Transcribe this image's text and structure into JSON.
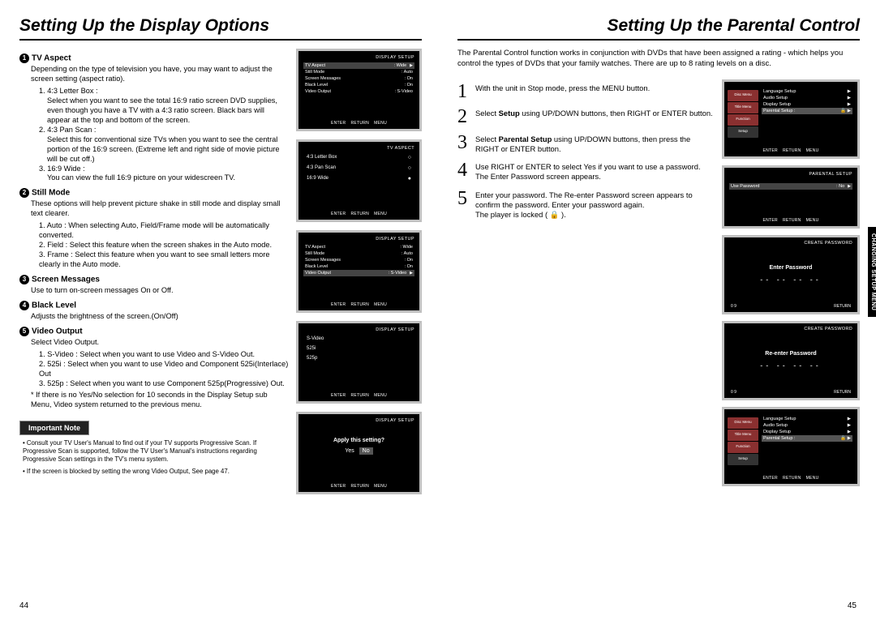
{
  "left": {
    "title": "Setting Up the Display Options",
    "sections": {
      "tvAspect": {
        "heading": "TV Aspect",
        "intro": "Depending on the type of television you have, you may want to adjust the screen setting (aspect ratio).",
        "items": [
          "1. 4:3 Letter Box :",
          "Select when you want to see the total 16:9 ratio screen DVD supplies, even though you have a TV with a 4:3 ratio screen. Black bars will appear at the top and bottom of the screen.",
          "2. 4:3 Pan Scan :",
          "Select this for conventional size TVs when you want to see the central portion of the 16:9 screen. (Extreme left and right side of movie picture will be cut off.)",
          "3. 16:9 Wide :",
          "You can view the full 16:9 picture on your widescreen TV."
        ]
      },
      "stillMode": {
        "heading": "Still Mode",
        "intro": "These options will help prevent picture shake in still mode and display small text clearer.",
        "items": [
          "1. Auto : When selecting Auto, Field/Frame mode will be automatically converted.",
          "2. Field : Select this feature when the screen shakes in the Auto mode.",
          "3. Frame : Select this feature when you want to see small letters more clearly in the Auto mode."
        ]
      },
      "screenMsg": {
        "heading": "Screen Messages",
        "body": "Use to turn on-screen messages On or Off."
      },
      "blackLevel": {
        "heading": "Black Level",
        "body": "Adjusts the brightness of the screen.(On/Off)"
      },
      "videoOut": {
        "heading": "Video Output",
        "intro": "Select Video Output.",
        "items": [
          "1. S-Video : Select when you want to use Video and S-Video Out.",
          "2. 525i : Select when you want to use Video and Component 525i(Interlace) Out",
          "3. 525p : Select when you want to use Component 525p(Progressive) Out."
        ],
        "note": "* If there is no Yes/No selection for 10 seconds in the Display Setup sub Menu, Video system returned to the previous menu."
      }
    },
    "importantNote": "Important Note",
    "finePrint": [
      "Consult your TV User's Manual to find out if your TV supports Progressive Scan. If Progressive Scan is supported, follow the TV User's Manual's instructions regarding Progressive Scan settings in the TV's menu system.",
      "If the screen is blocked by setting the wrong Video Output, See page 47."
    ],
    "pageNum": "44",
    "thumbs": {
      "displaySetup": "DISPLAY SETUP",
      "tvAspectTitle": "TV ASPECT",
      "footer": [
        "ENTER",
        "RETURN",
        "MENU"
      ],
      "rows1": [
        [
          "TV Aspect",
          ": Wide"
        ],
        [
          "Still Mode",
          ": Auto"
        ],
        [
          "Screen Messages",
          ": On"
        ],
        [
          "Black Level",
          ": On"
        ],
        [
          "Video Output",
          ": S-Video"
        ]
      ],
      "opts2": [
        "4:3 Letter Box",
        "4:3 Pan Scan",
        "16:9 Wide"
      ],
      "opts4": [
        "S-Video",
        "525i",
        "525p"
      ],
      "applyQ": "Apply this setting?",
      "yes": "Yes",
      "no": "No"
    }
  },
  "right": {
    "title": "Setting Up the Parental Control",
    "intro": "The Parental Control function works in conjunction with DVDs that have been assigned a rating - which helps you control the types of DVDs that your family watches. There are up to 8 rating levels on a disc.",
    "steps": [
      {
        "n": "1",
        "text": "With the unit in Stop mode, press the MENU button."
      },
      {
        "n": "2",
        "pre": "Select ",
        "bold": "Setup",
        "post": " using UP/DOWN buttons, then RIGHT or ENTER button."
      },
      {
        "n": "3",
        "pre": "Select ",
        "bold": "Parental Setup",
        "post": " using UP/DOWN buttons, then press the RIGHT or ENTER button."
      },
      {
        "n": "4",
        "text": "Use RIGHT or ENTER to select Yes if you want to use a password. The Enter Password screen appears."
      },
      {
        "n": "5",
        "text": "Enter your password. The Re-enter Password screen appears to confirm the password. Enter your password again.",
        "extra": "The player is locked ( 🔒 )."
      }
    ],
    "pageNum": "45",
    "tab": "CHANGING SETUP MENU",
    "thumbs": {
      "menuItems": [
        "Language Setup",
        "Audio Setup",
        "Display Setup",
        "Parental Setup :"
      ],
      "sideIcons": [
        "Disc Menu",
        "Title Menu",
        "Function",
        "Setup"
      ],
      "footer": [
        "ENTER",
        "RETURN",
        "MENU"
      ],
      "parentalSetup": "PARENTAL SETUP",
      "usePassword": "Use Password",
      "usePwVal": ": No",
      "createPassword": "CREATE PASSWORD",
      "enterPassword": "Enter Password",
      "reenterPassword": "Re-enter Password",
      "dashes": "-- -- -- --",
      "pwFootL": "0    9",
      "pwFootR": "RETURN"
    }
  }
}
